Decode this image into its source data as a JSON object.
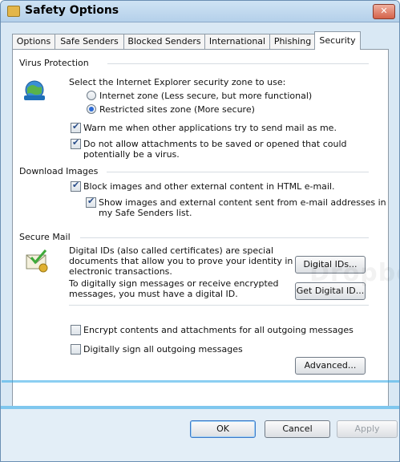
{
  "window": {
    "title": "Safety Options",
    "close_glyph": "✕"
  },
  "tabs": [
    {
      "label": "Options"
    },
    {
      "label": "Safe Senders"
    },
    {
      "label": "Blocked Senders"
    },
    {
      "label": "International"
    },
    {
      "label": "Phishing"
    },
    {
      "label": "Security"
    }
  ],
  "virus": {
    "heading": "Virus Protection",
    "zone_prompt": "Select the Internet Explorer security zone to use:",
    "radio_internet": "Internet zone (Less secure, but more functional)",
    "radio_restricted": "Restricted sites zone (More secure)",
    "warn_send": "Warn me when other applications try to send mail as me.",
    "no_attach_1": "Do not allow attachments to be saved or opened that could",
    "no_attach_2": "potentially be a virus."
  },
  "download": {
    "heading": "Download Images",
    "block_images": "Block images and other external content in HTML e-mail.",
    "show_safe_1": "Show images and external content sent from e-mail addresses in",
    "show_safe_2": "my Safe Senders list."
  },
  "secure": {
    "heading": "Secure Mail",
    "ids_1": "Digital IDs (also called certificates) are special",
    "ids_2": "documents that allow you to prove your identity in",
    "ids_3": "electronic transactions.",
    "sign_1": "To digitally sign messages or receive encrypted",
    "sign_2": "messages, you must have a digital ID.",
    "digital_ids_button": "Digital IDs...",
    "get_id_button": "Get Digital ID...",
    "encrypt": "Encrypt contents and attachments for all outgoing messages",
    "sign_all": "Digitally sign all outgoing messages",
    "advanced_button": "Advanced..."
  },
  "footer": {
    "ok": "OK",
    "cancel": "Cancel",
    "apply": "Apply"
  },
  "state": {
    "restricted_zone_selected": true,
    "warn_send_checked": true,
    "no_attach_checked": true,
    "block_images_checked": true,
    "show_safe_checked": true,
    "encrypt_checked": false,
    "sign_all_checked": false
  },
  "colors": {
    "title_bar": "#b4d0ea",
    "accent": "#2ea7e8",
    "close": "#d4624a"
  },
  "watermark": "Dropbook"
}
